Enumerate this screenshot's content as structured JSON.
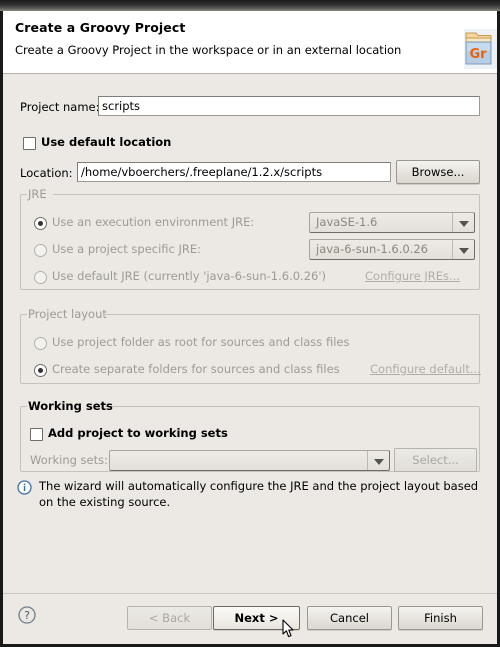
{
  "window": {
    "titlebar_color": "#2e2e2e",
    "body_color": "#ece9e4"
  },
  "header": {
    "title": "Create a Groovy Project",
    "subtitle": "Create a Groovy Project in the workspace or in an external location",
    "icon": "groovy-project-folder-icon",
    "icon_text": "Gr",
    "icon_accent": "#e8620c"
  },
  "form": {
    "project_name_label": "Project name:",
    "project_name_value": "scripts",
    "project_name_placeholder": "",
    "use_default_location_label": "Use default location",
    "use_default_location_checked": false,
    "location_label": "Location:",
    "location_value": "/home/vboerchers/.freeplane/1.2.x/scripts",
    "location_placeholder": "",
    "browse_label": "Browse..."
  },
  "jre": {
    "group_label": "JRE",
    "options": [
      {
        "label": "Use an execution environment JRE:",
        "selected": true,
        "combo_value": "JavaSE-1.6"
      },
      {
        "label": "Use a project specific JRE:",
        "selected": false,
        "combo_value": "java-6-sun-1.6.0.26"
      },
      {
        "label": "Use default JRE (currently 'java-6-sun-1.6.0.26')",
        "selected": false,
        "combo_value": ""
      }
    ],
    "configure_link": "Configure JREs..."
  },
  "project_layout": {
    "group_label": "Project layout",
    "options": [
      {
        "label": "Use project folder as root for sources and class files",
        "selected": false
      },
      {
        "label": "Create separate folders for sources and class files",
        "selected": true
      }
    ],
    "configure_link": "Configure default..."
  },
  "working_sets": {
    "group_label": "Working sets",
    "add_label": "Add project to working sets",
    "add_checked": false,
    "sets_label": "Working sets:",
    "sets_value": "",
    "select_label": "Select..."
  },
  "info": {
    "icon": "info-circle-icon",
    "message": "The wizard will automatically configure the JRE and the project layout based on the existing source.",
    "icon_color": "#3a6ea5"
  },
  "footer": {
    "help_icon": "help-question-icon",
    "buttons": [
      {
        "label": "< Back",
        "state": "disabled"
      },
      {
        "label": "Next >",
        "state": "default"
      },
      {
        "label": "Cancel",
        "state": "normal"
      },
      {
        "label": "Finish",
        "state": "normal"
      }
    ]
  }
}
